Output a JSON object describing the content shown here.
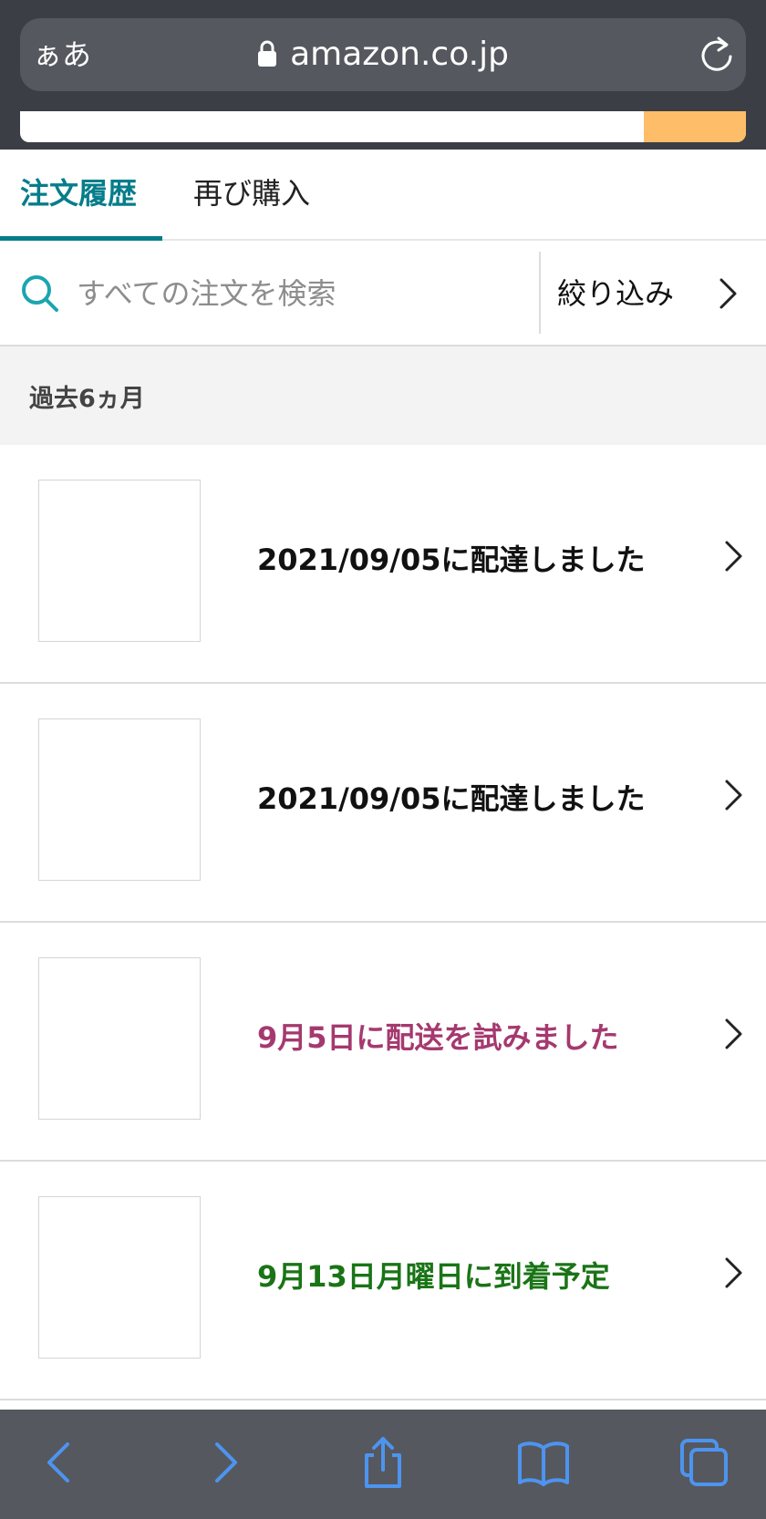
{
  "browser": {
    "text_size_label": "ぁあ",
    "url": "amazon.co.jp"
  },
  "tabs": [
    {
      "label": "注文履歴",
      "active": true
    },
    {
      "label": "再び購入",
      "active": false
    }
  ],
  "search": {
    "placeholder": "すべての注文を検索",
    "value": "",
    "filter_label": "絞り込み"
  },
  "section": {
    "title": "過去6ヵ月"
  },
  "orders": [
    {
      "status": "2021/09/05に配達しました",
      "status_color": "#111111"
    },
    {
      "status": "2021/09/05に配達しました",
      "status_color": "#111111"
    },
    {
      "status": "9月5日に配送を試みました",
      "status_color": "#a5396f"
    },
    {
      "status": "9月13日月曜日に到着予定",
      "status_color": "#1a7416"
    }
  ],
  "colors": {
    "accent": "#067d8a",
    "site_search_button": "#febd69",
    "toolbar_icon": "#4d94f0"
  },
  "toolbar": {
    "icons": [
      "back-icon",
      "forward-icon",
      "share-icon",
      "bookmarks-icon",
      "tabs-icon"
    ]
  }
}
